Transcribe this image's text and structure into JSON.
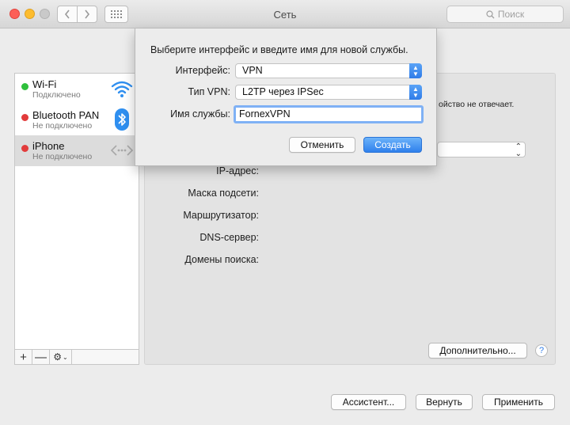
{
  "window": {
    "title": "Сеть",
    "search_placeholder": "Поиск"
  },
  "sidebar": {
    "items": [
      {
        "name": "Wi-Fi",
        "status": "Подключено",
        "status_color": "#2fc03c",
        "icon": "wifi-icon"
      },
      {
        "name": "Bluetooth PAN",
        "status": "Не подключено",
        "status_color": "#e23b3b",
        "icon": "bluetooth-icon"
      },
      {
        "name": "iPhone",
        "status": "Не подключено",
        "status_color": "#e23b3b",
        "icon": "iphone-connection-icon",
        "selected": true
      }
    ],
    "footer": {
      "add": "+",
      "remove": "—",
      "gear": "⚙︎"
    }
  },
  "detail": {
    "partial_status": "ойство не отвечает.",
    "fields": [
      "IP-адрес:",
      "Маска подсети:",
      "Маршрутизатор:",
      "DNS-сервер:",
      "Домены поиска:"
    ],
    "advanced_label": "Дополнительно...",
    "help_label": "?"
  },
  "bottom": {
    "assistant_label": "Ассистент...",
    "revert_label": "Вернуть",
    "apply_label": "Применить"
  },
  "sheet": {
    "prompt": "Выберите интерфейс и введите имя для новой службы.",
    "interface_label": "Интерфейс:",
    "interface_value": "VPN",
    "vpn_type_label": "Тип VPN:",
    "vpn_type_value": "L2TP через IPSec",
    "service_name_label": "Имя службы:",
    "service_name_value": "FornexVPN",
    "cancel_label": "Отменить",
    "create_label": "Создать"
  },
  "colors": {
    "accent": "#2f7ce8",
    "connected": "#2fc03c",
    "disconnected": "#e23b3b"
  }
}
